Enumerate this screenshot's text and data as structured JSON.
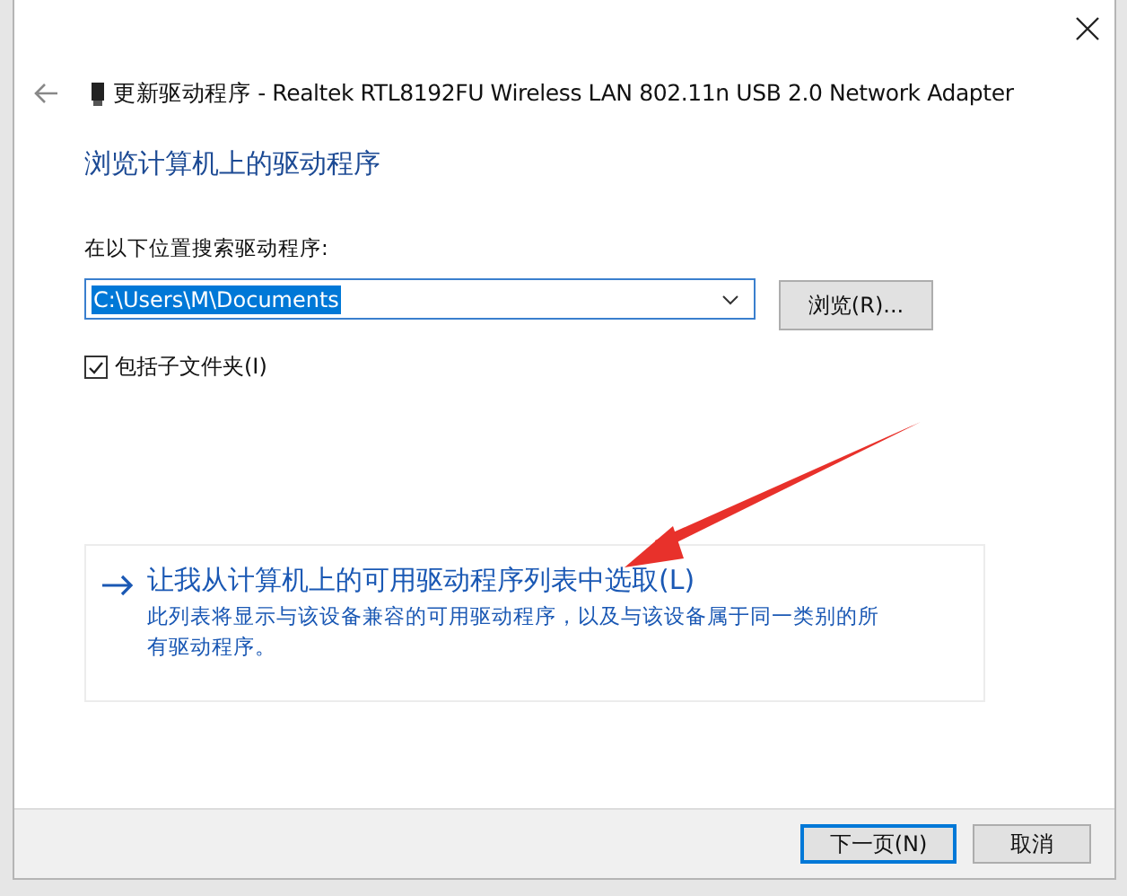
{
  "window": {
    "title": "更新驱动程序 - Realtek RTL8192FU Wireless LAN 802.11n USB 2.0 Network Adapter"
  },
  "heading": "浏览计算机上的驱动程序",
  "search": {
    "label": "在以下位置搜索驱动程序:",
    "value": "C:\\Users\\M\\Documents",
    "text_selected": true,
    "browse_button": "浏览(R)..."
  },
  "include_subfolders": {
    "label": "包括子文件夹(I)",
    "checked": true
  },
  "option": {
    "title": "让我从计算机上的可用驱动程序列表中选取(L)",
    "description": "此列表将显示与该设备兼容的可用驱动程序，以及与该设备属于同一类别的所有驱动程序。"
  },
  "buttons": [
    {
      "label": "下一页(N)",
      "default": true
    },
    {
      "label": "取消",
      "default": false
    }
  ]
}
